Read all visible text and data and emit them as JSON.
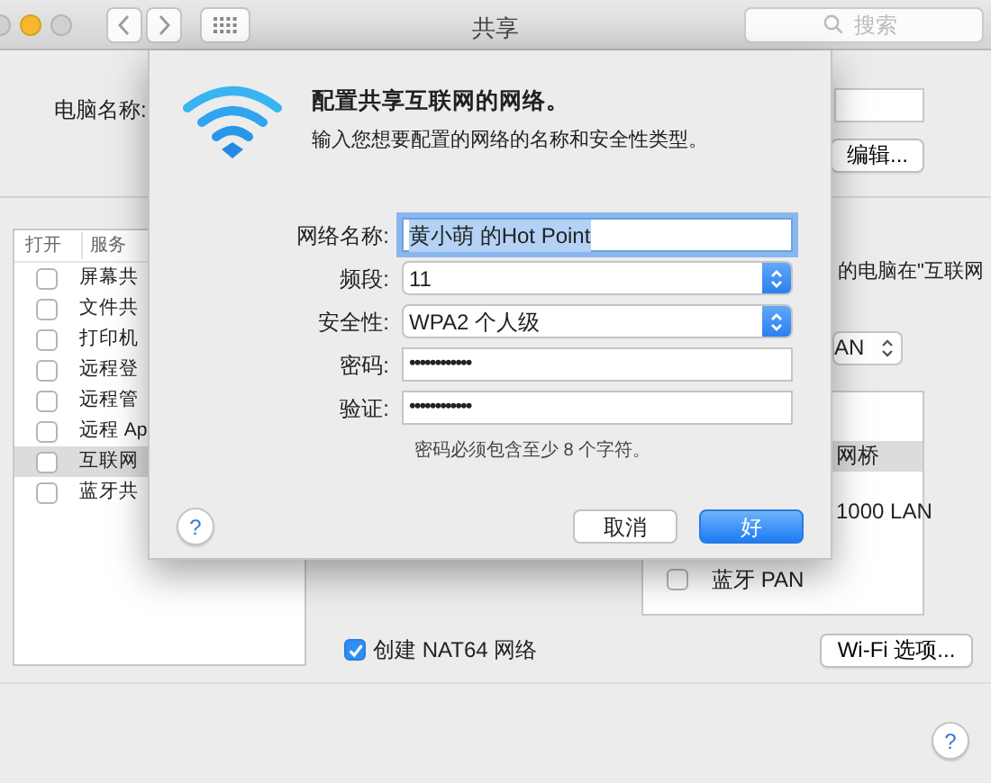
{
  "window": {
    "title": "共享",
    "search_placeholder": "搜索"
  },
  "computer_name": {
    "label": "电脑名称:",
    "edit_button": "编辑..."
  },
  "services": {
    "columns": [
      "打开",
      "服务"
    ],
    "rows": [
      {
        "name": "屏幕共",
        "checked": false,
        "selected": false
      },
      {
        "name": "文件共",
        "checked": false,
        "selected": false
      },
      {
        "name": "打印机",
        "checked": false,
        "selected": false
      },
      {
        "name": "远程登",
        "checked": false,
        "selected": false
      },
      {
        "name": "远程管",
        "checked": false,
        "selected": false
      },
      {
        "name": "远程 Ap",
        "checked": false,
        "selected": false
      },
      {
        "name": "互联网",
        "checked": false,
        "selected": true
      },
      {
        "name": "蓝牙共",
        "checked": false,
        "selected": false
      }
    ]
  },
  "service_detail": {
    "description": "的电脑在\"互联网",
    "share_from": "AN",
    "ports": [
      {
        "name": "网桥",
        "kind": "row",
        "selected": true
      },
      {
        "name": "1000 LAN",
        "kind": "row",
        "selected": false
      },
      {
        "name": "蓝牙 PAN",
        "kind": "checkbox",
        "checked": false,
        "selected": false
      }
    ],
    "nat64": {
      "label": "创建 NAT64 网络",
      "checked": true
    },
    "wifi_options_button": "Wi-Fi 选项..."
  },
  "help": "?",
  "dialog": {
    "title": "配置共享互联网的网络。",
    "subtitle": "输入您想要配置的网络的名称和安全性类型。",
    "fields": [
      {
        "label": "网络名称:",
        "kind": "text",
        "value": "黄小萌 的Hot Point",
        "focused": true
      },
      {
        "label": "频段:",
        "kind": "popup",
        "value": "11",
        "focused": false
      },
      {
        "label": "安全性:",
        "kind": "popup",
        "value": "WPA2 个人级",
        "focused": false
      },
      {
        "label": "密码:",
        "kind": "password",
        "value": "••••••••••••",
        "focused": false
      },
      {
        "label": "验证:",
        "kind": "password",
        "value": "••••••••••••",
        "focused": false
      }
    ],
    "hint": "密码必须包含至少 8 个字符。",
    "help": "?",
    "buttons": [
      {
        "label": "取消",
        "default": false
      },
      {
        "label": "好",
        "default": true
      }
    ]
  }
}
